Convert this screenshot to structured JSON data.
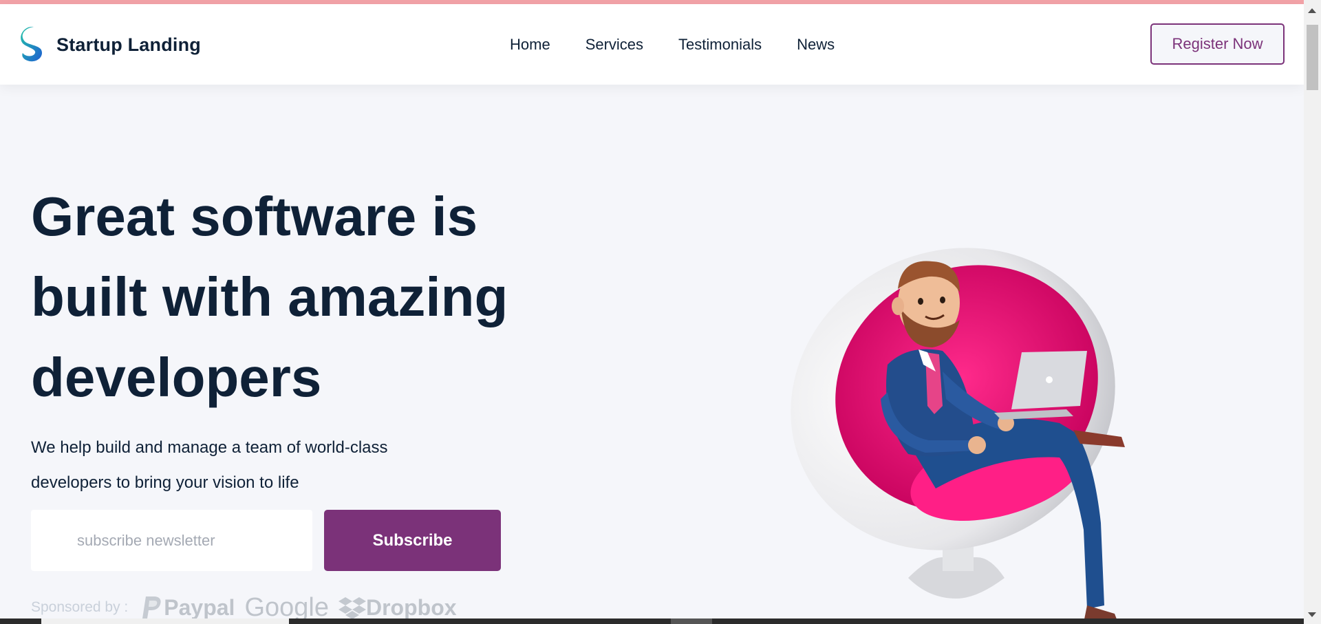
{
  "brand": {
    "name": "Startup Landing"
  },
  "nav": {
    "items": [
      {
        "label": "Home"
      },
      {
        "label": "Services"
      },
      {
        "label": "Testimonials"
      },
      {
        "label": "News"
      }
    ]
  },
  "header": {
    "register_label": "Register Now"
  },
  "hero": {
    "title": "Great software is built with amazing developers",
    "subtitle": "We help build and manage a team of world-class developers to bring your vision to life"
  },
  "newsletter": {
    "placeholder": "subscribe newsletter",
    "button_label": "Subscribe"
  },
  "sponsors": {
    "label": "Sponsored by :",
    "items": [
      {
        "name": "Paypal",
        "icon": "paypal-icon"
      },
      {
        "name": "Google",
        "icon": "google-logo"
      },
      {
        "name": "Dropbox",
        "icon": "dropbox-icon"
      }
    ]
  },
  "colors": {
    "primary": "#7b3279",
    "heading": "#0f2137",
    "background": "#f5f6fa",
    "chair_pink": "#e5096f"
  }
}
